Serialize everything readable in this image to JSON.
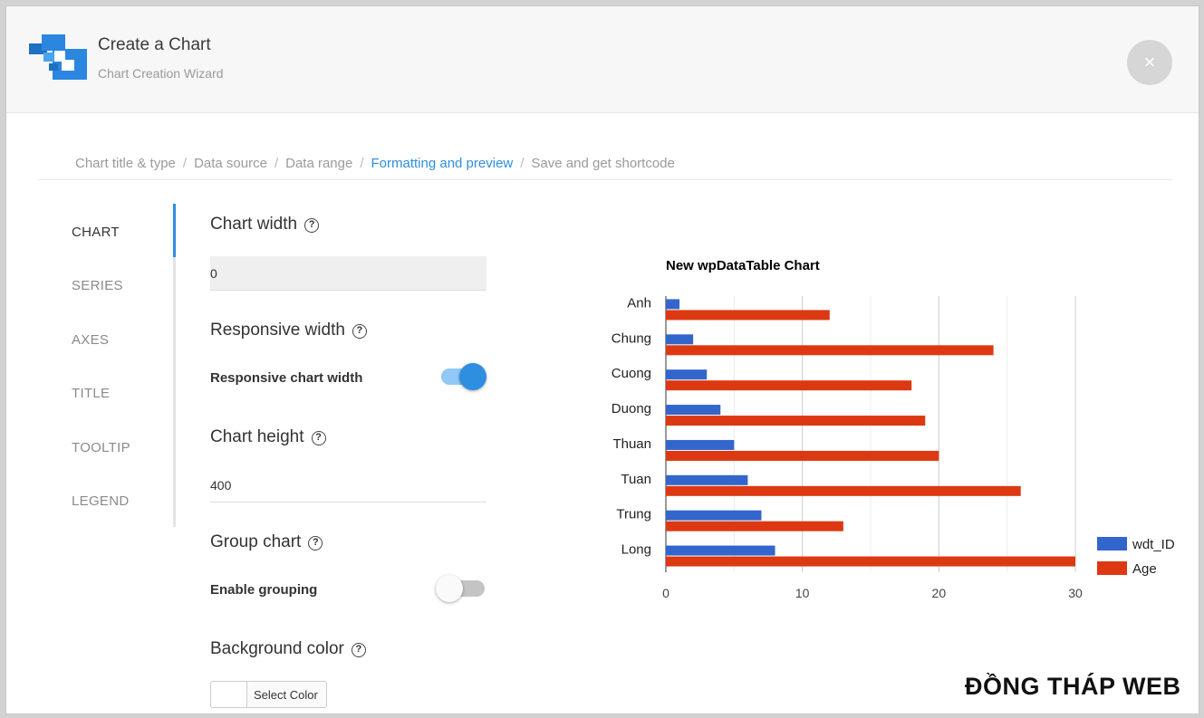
{
  "header": {
    "title": "Create a Chart",
    "subtitle": "Chart Creation Wizard",
    "close_label": "×"
  },
  "breadcrumb": [
    {
      "label": "Chart title & type",
      "active": false
    },
    {
      "label": "Data source",
      "active": false
    },
    {
      "label": "Data range",
      "active": false
    },
    {
      "label": "Formatting and preview",
      "active": true
    },
    {
      "label": "Save and get shortcode",
      "active": false
    }
  ],
  "breadcrumb_separator": "/",
  "sidebar": {
    "items": [
      {
        "label": "CHART",
        "active": true
      },
      {
        "label": "SERIES",
        "active": false
      },
      {
        "label": "AXES",
        "active": false
      },
      {
        "label": "TITLE",
        "active": false
      },
      {
        "label": "TOOLTIP",
        "active": false
      },
      {
        "label": "LEGEND",
        "active": false
      }
    ]
  },
  "settings": {
    "chart_width": {
      "title": "Chart width",
      "value": "0"
    },
    "responsive_width": {
      "title": "Responsive width",
      "toggle_label": "Responsive chart width",
      "enabled": true
    },
    "chart_height": {
      "title": "Chart height",
      "value": "400"
    },
    "group_chart": {
      "title": "Group chart",
      "toggle_label": "Enable grouping",
      "enabled": false
    },
    "background_color": {
      "title": "Background color",
      "button_label": "Select Color"
    },
    "help_glyph": "?"
  },
  "colors": {
    "accent": "#2e8ee0",
    "series_wdt_id": "#3366cc",
    "series_age": "#dc3912",
    "toggle_on_track": "#90c8f8",
    "toggle_off_track": "#c4c4c4"
  },
  "chart_data": {
    "type": "bar",
    "orientation": "horizontal",
    "title": "New wpDataTable Chart",
    "categories": [
      "Anh",
      "Chung",
      "Cuong",
      "Duong",
      "Thuan",
      "Tuan",
      "Trung",
      "Long"
    ],
    "series": [
      {
        "name": "wdt_ID",
        "values": [
          1,
          2,
          3,
          4,
          5,
          6,
          7,
          8
        ]
      },
      {
        "name": "Age",
        "values": [
          12,
          24,
          18,
          19,
          20,
          26,
          13,
          30
        ]
      }
    ],
    "xlim": [
      0,
      30
    ],
    "x_ticks": [
      0,
      10,
      20,
      30
    ],
    "grid": true,
    "legend_position": "right-bottom"
  },
  "watermark": "ĐỒNG THÁP WEB"
}
